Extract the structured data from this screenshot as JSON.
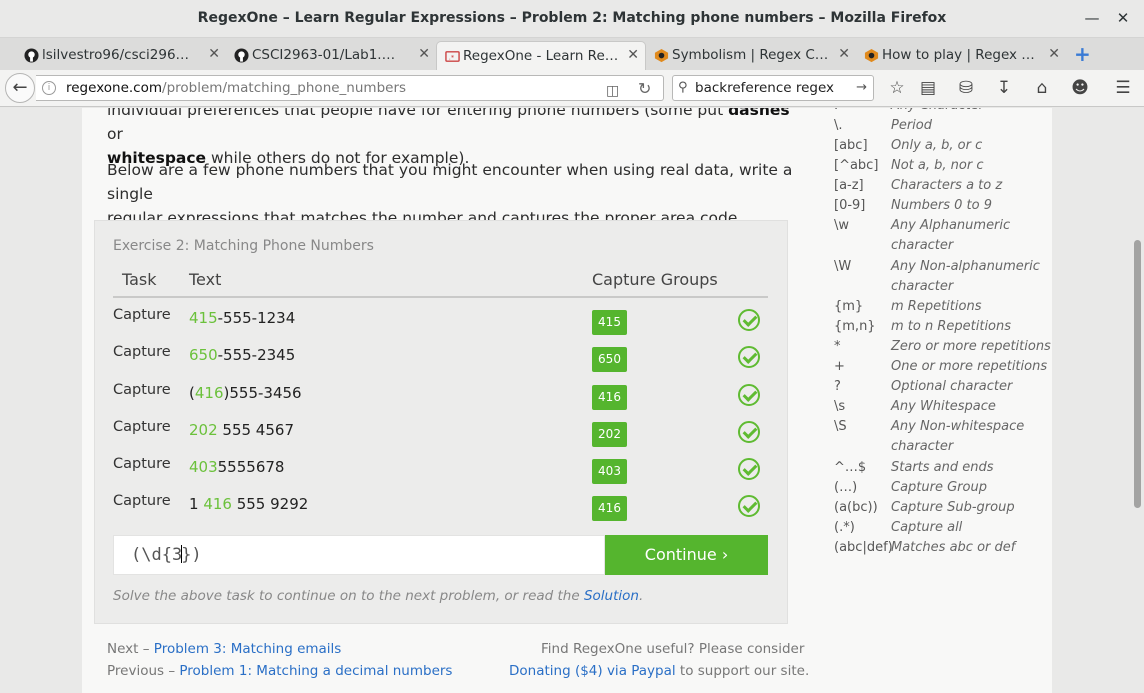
{
  "window": {
    "title": "RegexOne – Learn Regular Expressions – Problem 2: Matching phone numbers – Mozilla Firefox"
  },
  "tabs": [
    {
      "label": "lsilvestro96/csci296…",
      "icon": "github-icon"
    },
    {
      "label": "CSCI2963-01/Lab1.…",
      "icon": "github-icon"
    },
    {
      "label": "RegexOne - Learn Re…",
      "icon": "regexone-icon",
      "active": true
    },
    {
      "label": "Symbolism | Regex C…",
      "icon": "regex-crossword-icon"
    },
    {
      "label": "How to play | Regex …",
      "icon": "regex-crossword-icon"
    }
  ],
  "nav": {
    "url_domain": "regexone.com",
    "url_path": "/problem/matching_phone_numbers",
    "search_value": "backreference regex"
  },
  "lesson": {
    "p1_a": "individual preferences that people have for entering phone numbers (some put ",
    "p1_b": "dashes",
    "p1_c": " or",
    "p1_d": "whitespace",
    "p1_e": " while others do not for example).",
    "p2_line1": "Below are a few phone numbers that you might encounter when using real data, write a single",
    "p2_line2": "regular expressions that matches the number and captures the proper area code."
  },
  "exercise": {
    "title": "Exercise 2: Matching Phone Numbers",
    "headers": {
      "task": "Task",
      "text": "Text",
      "groups": "Capture Groups"
    },
    "rows": [
      {
        "task": "Capture",
        "pre": "",
        "hl": "415",
        "post": "-555-1234",
        "group": "415"
      },
      {
        "task": "Capture",
        "pre": "",
        "hl": "650",
        "post": "-555-2345",
        "group": "650"
      },
      {
        "task": "Capture",
        "pre": "(",
        "hl": "416",
        "post": ")555-3456",
        "group": "416"
      },
      {
        "task": "Capture",
        "pre": "",
        "hl": "202",
        "post": " 555 4567",
        "group": "202"
      },
      {
        "task": "Capture",
        "pre": "",
        "hl": "403",
        "post": "5555678",
        "group": "403"
      },
      {
        "task": "Capture",
        "pre": "1 ",
        "hl": "416",
        "post": " 555 9292",
        "group": "416"
      }
    ],
    "input_before_caret": "(\\d{3",
    "input_after_caret": "})",
    "continue_label": "Continue ›",
    "note_before": "Solve the above task to continue on to the next problem, or read the ",
    "note_link": "Solution",
    "note_after": "."
  },
  "footer": {
    "next_prefix": "Next – ",
    "next_link": "Problem 3: Matching emails",
    "prev_prefix": "Previous – ",
    "prev_link": "Problem 1: Matching a decimal numbers",
    "donate_line1": "Find RegexOne useful? Please consider",
    "donate_link": "Donating ($4) via Paypal",
    "donate_suffix": " to support our site."
  },
  "cheatsheet": [
    {
      "sym": ".",
      "desc": "Any Character"
    },
    {
      "sym": "\\.",
      "desc": "Period"
    },
    {
      "sym": "[abc]",
      "desc": "Only a, b, or c"
    },
    {
      "sym": "[^abc]",
      "desc": "Not a, b, nor c"
    },
    {
      "sym": "[a-z]",
      "desc": "Characters a to z"
    },
    {
      "sym": "[0-9]",
      "desc": "Numbers 0 to 9"
    },
    {
      "sym": "\\w",
      "desc": "Any Alphanumeric",
      "desc2": "character"
    },
    {
      "sym": "\\W",
      "desc": "Any Non-alphanumeric",
      "desc2": "character"
    },
    {
      "sym": "{m}",
      "desc": "m Repetitions"
    },
    {
      "sym": "{m,n}",
      "desc": "m to n Repetitions"
    },
    {
      "sym": "*",
      "desc": "Zero or more repetitions"
    },
    {
      "sym": "+",
      "desc": "One or more repetitions"
    },
    {
      "sym": "?",
      "desc": "Optional character"
    },
    {
      "sym": "\\s",
      "desc": "Any Whitespace"
    },
    {
      "sym": "\\S",
      "desc": "Any Non-whitespace",
      "desc2": "character"
    },
    {
      "sym": "^…$",
      "desc": "Starts and ends"
    },
    {
      "sym": "(…)",
      "desc": "Capture Group"
    },
    {
      "sym": "(a(bc))",
      "desc": "Capture Sub-group"
    },
    {
      "sym": "(.*)",
      "desc": "Capture all"
    },
    {
      "sym": "(abc|def)",
      "desc": "Matches abc or def"
    }
  ],
  "colors": {
    "accent_green": "#55b52e",
    "highlight_green": "#6bc13b",
    "link_blue": "#2a6fc6"
  }
}
